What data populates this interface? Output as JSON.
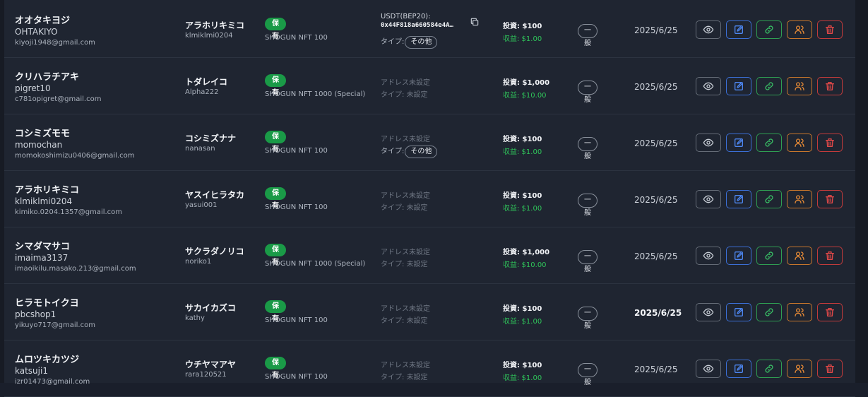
{
  "rows": [
    {
      "name_ja": "オオタキヨジ",
      "username": "OHTAKIYO",
      "email": "kiyoji1948@gmail.com",
      "ref_name": "アラホリキミコ",
      "ref_user": "klmiklmi0204",
      "status": "保有",
      "nft": "SHOGUN NFT 100",
      "address_label": "USDT(BEP20):",
      "address": "0x44F818a660584e4A…",
      "address_set": true,
      "type_label": "タイプ:",
      "type_value": "その他",
      "type_pill": true,
      "invest": "投資: $100",
      "profit": "収益: $1.00",
      "rank": "一般",
      "date": "2025/6/25",
      "date_bold": false
    },
    {
      "name_ja": "クリハラチアキ",
      "username": "pigret10",
      "email": "c781opigret@gmail.com",
      "ref_name": "トダレイコ",
      "ref_user": "Alpha222",
      "status": "保有",
      "nft": "SHOGUN NFT 1000 (Special)",
      "address_label": "アドレス未設定",
      "address": "",
      "address_set": false,
      "type_label": "タイプ:",
      "type_value": "未設定",
      "type_pill": false,
      "invest": "投資: $1,000",
      "profit": "収益: $10.00",
      "rank": "一般",
      "date": "2025/6/25",
      "date_bold": false
    },
    {
      "name_ja": "コシミズモモ",
      "username": "momochan",
      "email": "momokoshimizu0406@gmail.com",
      "ref_name": "コシミズナナ",
      "ref_user": "nanasan",
      "status": "保有",
      "nft": "SHOGUN NFT 100",
      "address_label": "アドレス未設定",
      "address": "",
      "address_set": false,
      "type_label": "タイプ:",
      "type_value": "その他",
      "type_pill": true,
      "invest": "投資: $100",
      "profit": "収益: $1.00",
      "rank": "一般",
      "date": "2025/6/25",
      "date_bold": false
    },
    {
      "name_ja": "アラホリキミコ",
      "username": "klmiklmi0204",
      "email": "kimiko.0204.1357@gmail.com",
      "ref_name": "ヤスイヒラタカ",
      "ref_user": "yasui001",
      "status": "保有",
      "nft": "SHOGUN NFT 100",
      "address_label": "アドレス未設定",
      "address": "",
      "address_set": false,
      "type_label": "タイプ:",
      "type_value": "未設定",
      "type_pill": false,
      "invest": "投資: $100",
      "profit": "収益: $1.00",
      "rank": "一般",
      "date": "2025/6/25",
      "date_bold": false
    },
    {
      "name_ja": "シマダマサコ",
      "username": "imaima3137",
      "email": "imaoikilu.masako.213@gmail.com",
      "ref_name": "サクラダノリコ",
      "ref_user": "noriko1",
      "status": "保有",
      "nft": "SHOGUN NFT 1000 (Special)",
      "address_label": "アドレス未設定",
      "address": "",
      "address_set": false,
      "type_label": "タイプ:",
      "type_value": "未設定",
      "type_pill": false,
      "invest": "投資: $1,000",
      "profit": "収益: $10.00",
      "rank": "一般",
      "date": "2025/6/25",
      "date_bold": false
    },
    {
      "name_ja": "ヒラモトイクヨ",
      "username": "pbcshop1",
      "email": "yikuyo717@gmail.com",
      "ref_name": "サカイカズコ",
      "ref_user": "kathy",
      "status": "保有",
      "nft": "SHOGUN NFT 100",
      "address_label": "アドレス未設定",
      "address": "",
      "address_set": false,
      "type_label": "タイプ:",
      "type_value": "未設定",
      "type_pill": false,
      "invest": "投資: $100",
      "profit": "収益: $1.00",
      "rank": "一般",
      "date": "2025/6/25",
      "date_bold": true
    },
    {
      "name_ja": "ムロツキカツジ",
      "username": "katsuji1",
      "email": "izr01473@gmail.com",
      "ref_name": "ウチヤマアヤ",
      "ref_user": "rara120521",
      "status": "保有",
      "nft": "SHOGUN NFT 100",
      "address_label": "アドレス未設定",
      "address": "",
      "address_set": false,
      "type_label": "タイプ:",
      "type_value": "未設定",
      "type_pill": false,
      "invest": "投資: $100",
      "profit": "収益: $1.00",
      "rank": "一般",
      "date": "2025/6/25",
      "date_bold": false
    }
  ],
  "icons": {
    "view": "eye-icon",
    "edit": "edit-icon",
    "link": "link-icon",
    "users": "users-icon",
    "delete": "trash-icon",
    "copy": "copy-icon"
  },
  "colors": {
    "status_green": "#1a9a47",
    "profit_green": "#2fc45a",
    "edit_blue": "#3b6fd6",
    "users_orange": "#c7762c",
    "delete_red": "#c23b3b"
  }
}
